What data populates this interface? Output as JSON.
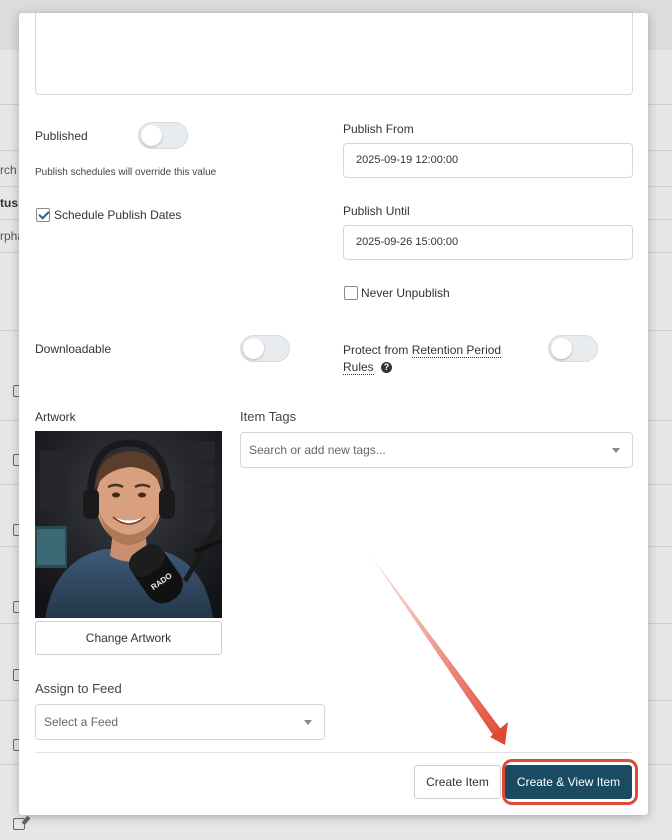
{
  "background": {
    "fragments": [
      "rch",
      "tus:",
      "rpha"
    ]
  },
  "publish": {
    "published_label": "Published",
    "override_help": "Publish schedules will override this value",
    "schedule_label": "Schedule Publish Dates",
    "schedule_checked": true,
    "publish_from_label": "Publish From",
    "publish_from_value": "2025-09-19 12:00:00",
    "publish_until_label": "Publish Until",
    "publish_until_value": "2025-09-26 15:00:00",
    "never_unpublish_label": "Never Unpublish",
    "never_unpublish_checked": false
  },
  "options": {
    "downloadable_label": "Downloadable",
    "protect_label_prefix": "Protect from ",
    "protect_label_link": "Retention Period Rules",
    "help_icon": "question-circle-icon"
  },
  "artwork": {
    "label": "Artwork",
    "image_alt": "Podcast host smiling at microphone",
    "mic_text": "RADO",
    "change_button": "Change Artwork"
  },
  "tags": {
    "label": "Item Tags",
    "placeholder": "Search or add new tags..."
  },
  "feed": {
    "label": "Assign to Feed",
    "placeholder": "Select a Feed"
  },
  "footer": {
    "create_label": "Create Item",
    "create_view_label": "Create & View Item"
  },
  "colors": {
    "primary": "#1a4b63",
    "annotation": "#e04a35"
  }
}
